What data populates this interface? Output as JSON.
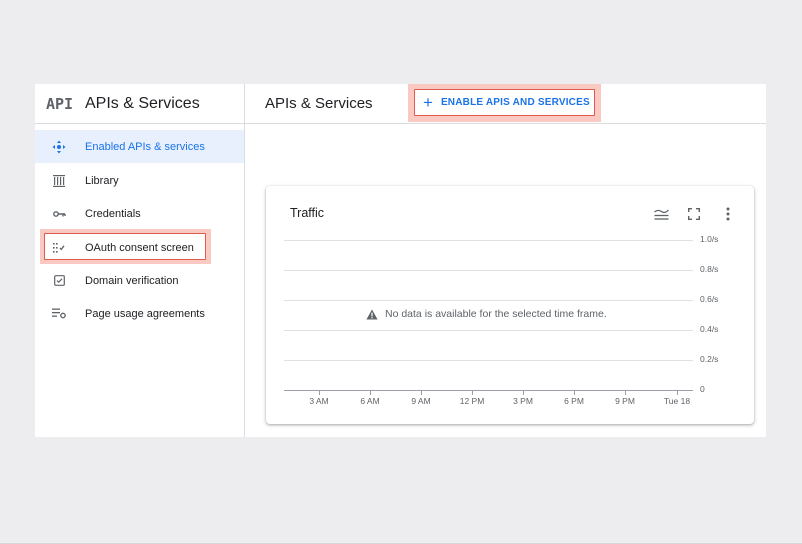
{
  "sidebar": {
    "logo": "API",
    "title": "APIs & Services",
    "items": [
      {
        "label": "Enabled APIs & services",
        "icon": "enabled-apis-icon",
        "active": true
      },
      {
        "label": "Library",
        "icon": "library-icon"
      },
      {
        "label": "Credentials",
        "icon": "key-icon"
      },
      {
        "label": "OAuth consent screen",
        "icon": "consent-icon",
        "highlighted": true
      },
      {
        "label": "Domain verification",
        "icon": "checkbox-icon"
      },
      {
        "label": "Page usage agreements",
        "icon": "settings-list-icon"
      }
    ]
  },
  "header": {
    "title": "APIs & Services",
    "enable_button": "ENABLE APIS AND SERVICES"
  },
  "traffic_card": {
    "title": "Traffic",
    "no_data": "No data is available for the selected time frame.",
    "y_ticks": [
      "1.0/s",
      "0.8/s",
      "0.6/s",
      "0.4/s",
      "0.2/s",
      "0"
    ],
    "x_ticks": [
      "3 AM",
      "6 AM",
      "9 AM",
      "12 PM",
      "3 PM",
      "6 PM",
      "9 PM",
      "Tue 18"
    ]
  },
  "colors": {
    "accent": "#1a73e8",
    "active_bg": "#e8f0fe",
    "highlight_border": "#e05b4b",
    "highlight_fill": "#f9c9c2"
  }
}
